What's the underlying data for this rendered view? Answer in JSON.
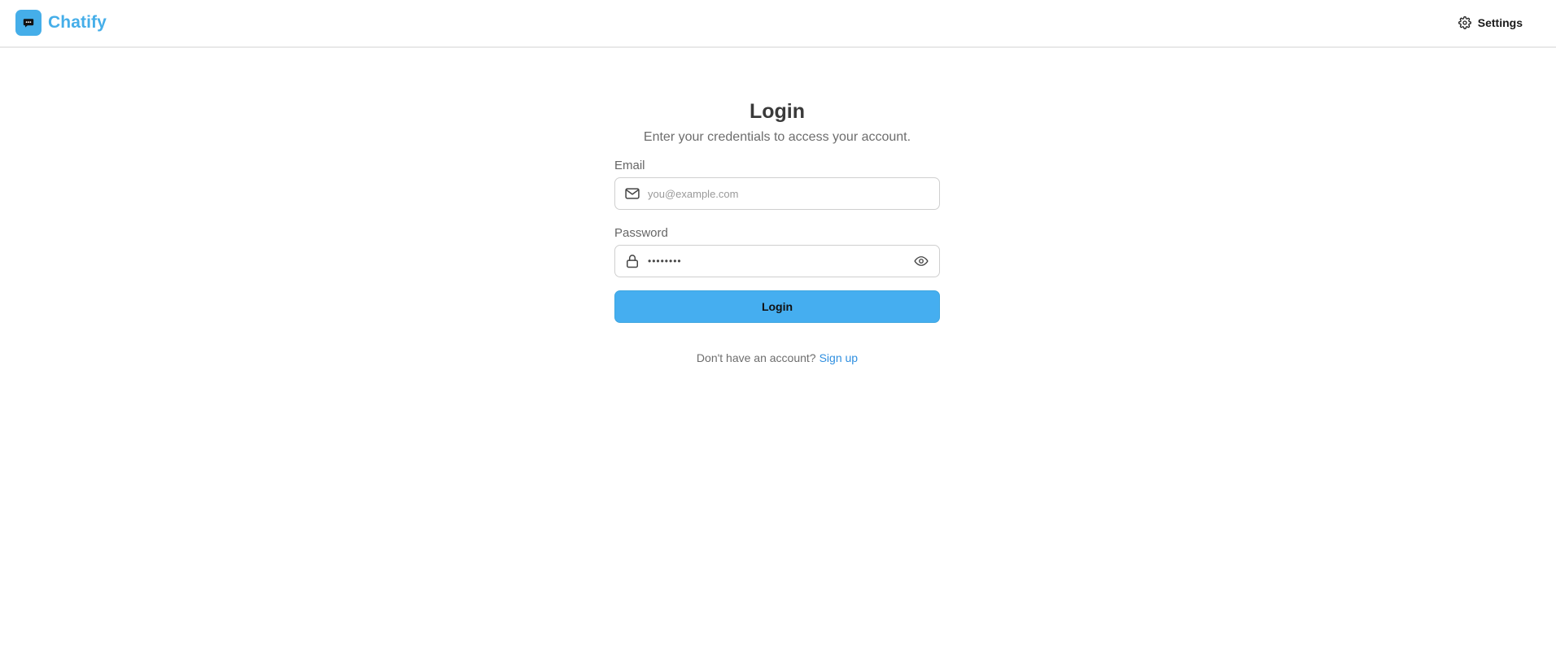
{
  "header": {
    "brand_name": "Chatify",
    "brand_icon": "chat-bubble-icon",
    "settings_label": "Settings",
    "settings_icon": "gear-icon",
    "accent_color": "#45aee9"
  },
  "login": {
    "title": "Login",
    "subtitle": "Enter your credentials to access your account.",
    "email": {
      "label": "Email",
      "placeholder": "you@example.com",
      "value": "",
      "icon": "mail-icon"
    },
    "password": {
      "label": "Password",
      "value": "••••••••",
      "icon": "lock-icon",
      "toggle_icon": "eye-icon"
    },
    "submit_label": "Login",
    "signup_prompt": "Don't have an account?",
    "signup_link": "Sign up"
  }
}
